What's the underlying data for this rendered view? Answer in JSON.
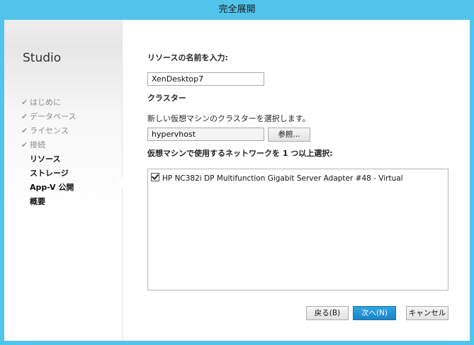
{
  "window": {
    "title": "完全展開"
  },
  "sidebar": {
    "title": "Studio",
    "steps": [
      {
        "label": "はじめに",
        "state": "done"
      },
      {
        "label": "データベース",
        "state": "done"
      },
      {
        "label": "ライセンス",
        "state": "done"
      },
      {
        "label": "接続",
        "state": "done"
      },
      {
        "label": "リソース",
        "state": "current"
      },
      {
        "label": "ストレージ",
        "state": "pending"
      },
      {
        "label": "App-V 公開",
        "state": "pending"
      },
      {
        "label": "概要",
        "state": "pending"
      }
    ]
  },
  "resource": {
    "name_label": "リソースの名前を入力:",
    "name_value": "XenDesktop7"
  },
  "cluster": {
    "heading": "クラスター",
    "instruction": "新しい仮想マシンのクラスターを選択します。",
    "value": "hypervhost",
    "browse_label": "参照..."
  },
  "network": {
    "heading": "仮想マシンで使用するネットワークを 1 つ以上選択:",
    "items": [
      {
        "label": "HP NC382i DP Multifunction Gigabit Server Adapter #48 - Virtual",
        "checked": true
      }
    ]
  },
  "footer": {
    "back_label": "戻る(B)",
    "next_label": "次へ(N)",
    "cancel_label": "キャンセル"
  },
  "colors": {
    "titlebar": "#51c4ec",
    "primary_button": "#1a84c7"
  }
}
